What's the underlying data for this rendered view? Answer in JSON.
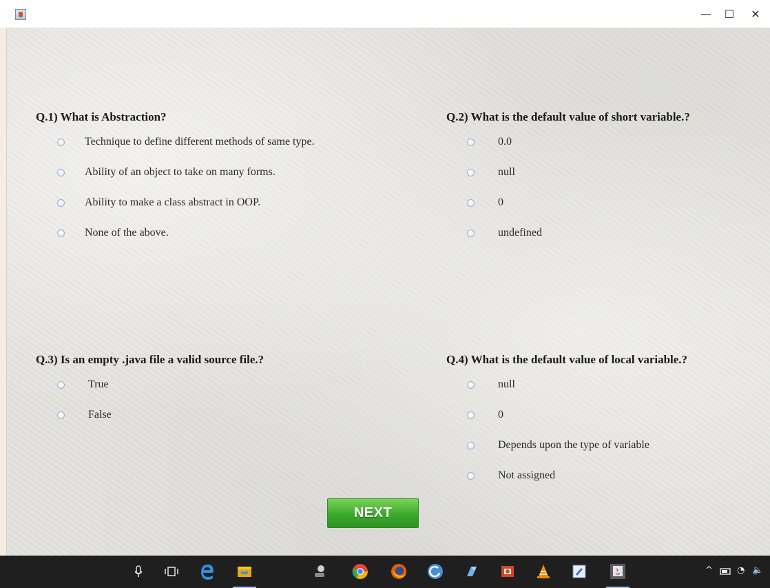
{
  "window": {
    "controls": {
      "minimize": "—",
      "maximize": "☐",
      "close": "✕"
    }
  },
  "questions": [
    {
      "title": "Q.1) What is Abstraction?",
      "options": [
        "Technique to define different methods of same type.",
        "Ability of an object to take on many forms.",
        "Ability to make a class abstract in OOP.",
        "None of the above."
      ]
    },
    {
      "title": "Q.2) What is the default value of short variable.?",
      "options": [
        "0.0",
        "null",
        "0",
        "undefined"
      ]
    },
    {
      "title": "Q.3) Is an empty .java file a valid source file.?",
      "options": [
        "True",
        "False"
      ]
    },
    {
      "title": "Q.4) What is the default value of local variable.?",
      "options": [
        "null",
        "0",
        "Depends upon the type of variable",
        "Not assigned"
      ]
    }
  ],
  "next_button": {
    "label": "NEXT"
  },
  "taskbar": {
    "icons": [
      "microphone-icon",
      "task-view-icon",
      "edge-icon",
      "file-explorer-icon",
      "network-icon",
      "chrome-icon",
      "firefox-icon",
      "browser-icon",
      "app-icon",
      "powerpoint-icon",
      "vlc-icon",
      "editor-icon",
      "java-icon"
    ],
    "tray": {
      "chevron": "^",
      "wifi": "◔",
      "volume": "🔈"
    }
  },
  "colors": {
    "next_green": "#3ba92c",
    "taskbar": "#1f1f1f",
    "paper": "#e3e2de"
  }
}
